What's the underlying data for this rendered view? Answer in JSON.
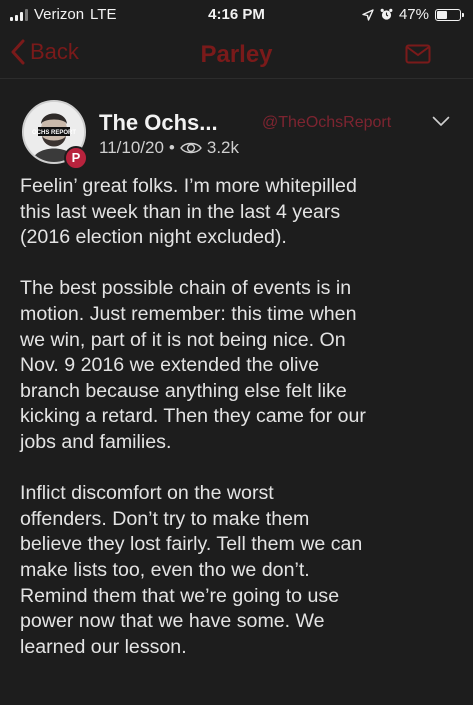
{
  "status_bar": {
    "carrier": "Verizon",
    "network": "LTE",
    "time": "4:16 PM",
    "battery_percent": "47%",
    "battery_level": 0.47,
    "icons": [
      "signal-icon",
      "location-icon",
      "alarm-icon",
      "battery-icon"
    ]
  },
  "nav": {
    "back_label": "Back",
    "title": "Parley",
    "accent_color": "#7a1a1a",
    "icons": [
      "chevron-left-icon",
      "mail-icon"
    ]
  },
  "post": {
    "display_name": "The Ochs...",
    "handle": "@TheOchsReport",
    "date": "11/10/20",
    "separator": "•",
    "views": "3.2k",
    "avatar_text": "OCHS REPORT",
    "badge_letter": "P",
    "badge_color": "#b8233d",
    "paragraphs": [
      "Feelin’ great folks. I’m more whitepilled\nthis last week than in the last 4 years\n(2016 election night excluded).",
      "The best possible chain of events is in\nmotion. Just remember: this time when\nwe win, part of it is not being nice. On\nNov. 9 2016 we extended the olive\nbranch because anything else felt like\nkicking a retard. Then they came for our\njobs and families.",
      "Inflict discomfort on the worst\noffenders. Don’t try to make them\nbelieve they lost fairly. Tell them we can\nmake lists too, even tho we don’t.\nRemind them that we’re going to use\npower now that we have some. We\nlearned our lesson."
    ]
  }
}
